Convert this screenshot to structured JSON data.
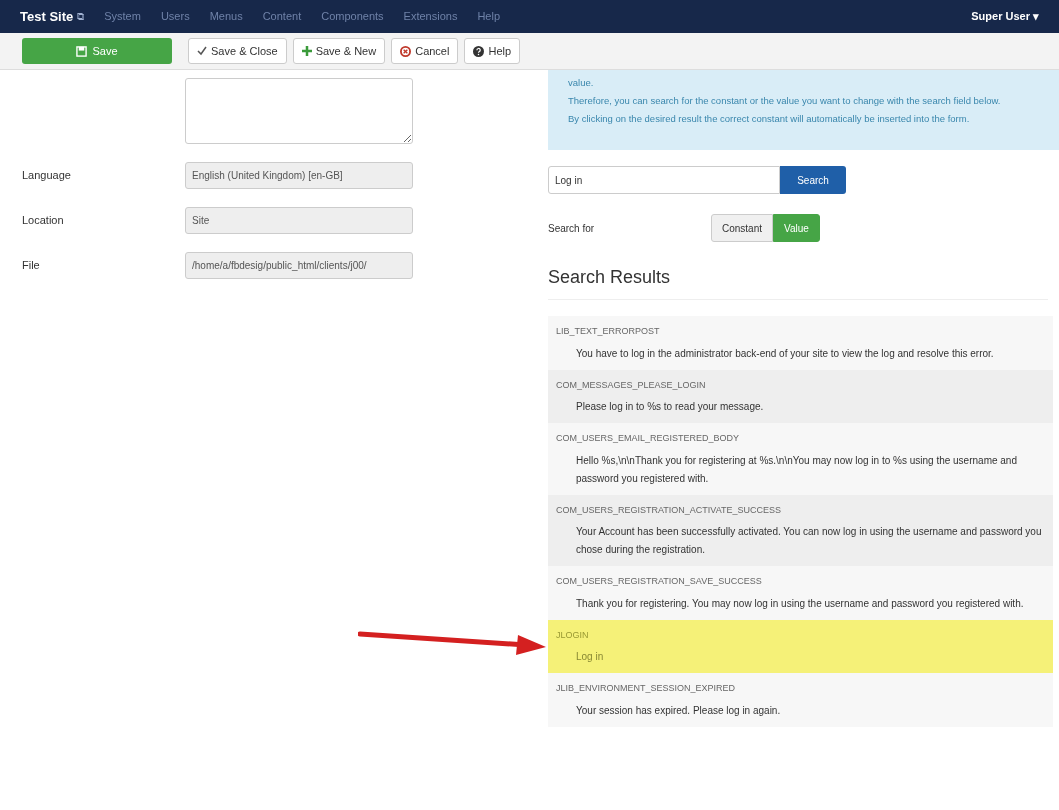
{
  "navbar": {
    "brand": "Test Site",
    "brand_icon": "⧉",
    "menu": [
      "System",
      "Users",
      "Menus",
      "Content",
      "Components",
      "Extensions",
      "Help"
    ],
    "user": "Super User",
    "user_caret": "▾"
  },
  "toolbar": [
    {
      "kind": "primary",
      "label": "Save"
    },
    {
      "kind": "check",
      "label": "Save & Close"
    },
    {
      "kind": "plus",
      "label": "Save & New"
    },
    {
      "kind": "cancel",
      "label": "Cancel"
    },
    {
      "kind": "help",
      "label": "Help"
    }
  ],
  "form": {
    "fields": [
      {
        "label": "Language",
        "value": "English (United Kingdom) [en-GB]"
      },
      {
        "label": "Location",
        "value": "Site"
      },
      {
        "label": "File",
        "value": "/home/a/fbdesig/public_html/clients/j00/"
      }
    ]
  },
  "info": [
    "value.",
    "Therefore, you can search for the constant or the value you want to change with the search field below.",
    "By clicking on the desired result the correct constant will automatically be inserted into the form."
  ],
  "search": {
    "value": "Log in",
    "button": "Search",
    "label": "Search for",
    "options": [
      {
        "label": "Constant",
        "selected": false
      },
      {
        "label": "Value",
        "selected": true
      }
    ]
  },
  "results": {
    "title": "Search Results",
    "items": [
      {
        "constant": "LIB_TEXT_ERRORPOST",
        "text": "You have to log in the administrator back-end of your site to view the log and resolve this error.",
        "selected": false
      },
      {
        "constant": "COM_MESSAGES_PLEASE_LOGIN",
        "text": "Please log in to %s to read your message.",
        "selected": false
      },
      {
        "constant": "COM_USERS_EMAIL_REGISTERED_BODY",
        "text": "Hello %s,\\n\\nThank you for registering at %s.\\n\\nYou may now log in to %s using the username and password you registered with.",
        "selected": false
      },
      {
        "constant": "COM_USERS_REGISTRATION_ACTIVATE_SUCCESS",
        "text": "Your Account has been successfully activated. You can now log in using the username and password you chose during the registration.",
        "selected": false
      },
      {
        "constant": "COM_USERS_REGISTRATION_SAVE_SUCCESS",
        "text": "Thank you for registering. You may now log in using the username and password you registered with.",
        "selected": false
      },
      {
        "constant": "JLOGIN",
        "text": "Log in",
        "selected": true
      },
      {
        "constant": "JLIB_ENVIRONMENT_SESSION_EXPIRED",
        "text": "Your session has expired. Please log in again.",
        "selected": false
      }
    ]
  }
}
